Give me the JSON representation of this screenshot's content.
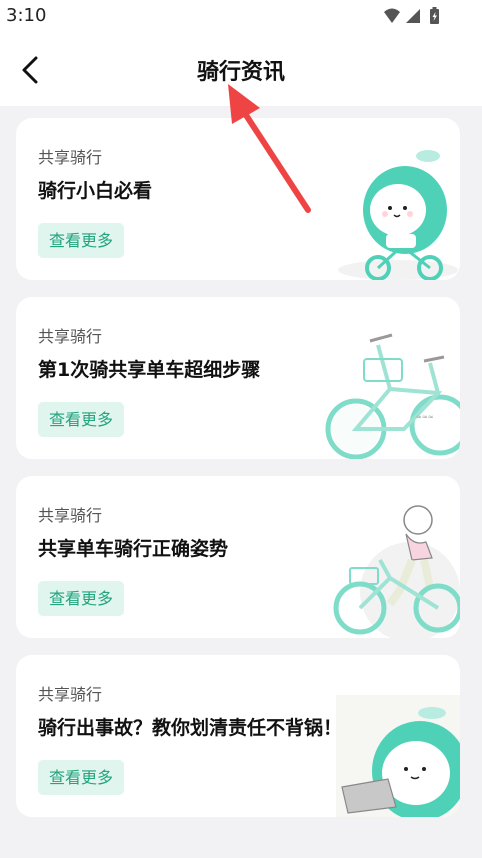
{
  "status_bar": {
    "time": "3:10"
  },
  "header": {
    "title": "骑行资讯"
  },
  "articles": [
    {
      "category": "共享骑行",
      "title": "骑行小白必看",
      "more_label": "查看更多"
    },
    {
      "category": "共享骑行",
      "title": "第1次骑共享单车超细步骤",
      "more_label": "查看更多"
    },
    {
      "category": "共享骑行",
      "title": "共享单车骑行正确姿势",
      "more_label": "查看更多"
    },
    {
      "category": "共享骑行",
      "title": "骑行出事故？教你划清责任不背锅！",
      "more_label": "查看更多"
    }
  ],
  "colors": {
    "accent": "#23a47d",
    "accent_bg": "#dff5ee",
    "mascot": "#4fd1b8",
    "annotation_arrow": "#ef4444"
  }
}
